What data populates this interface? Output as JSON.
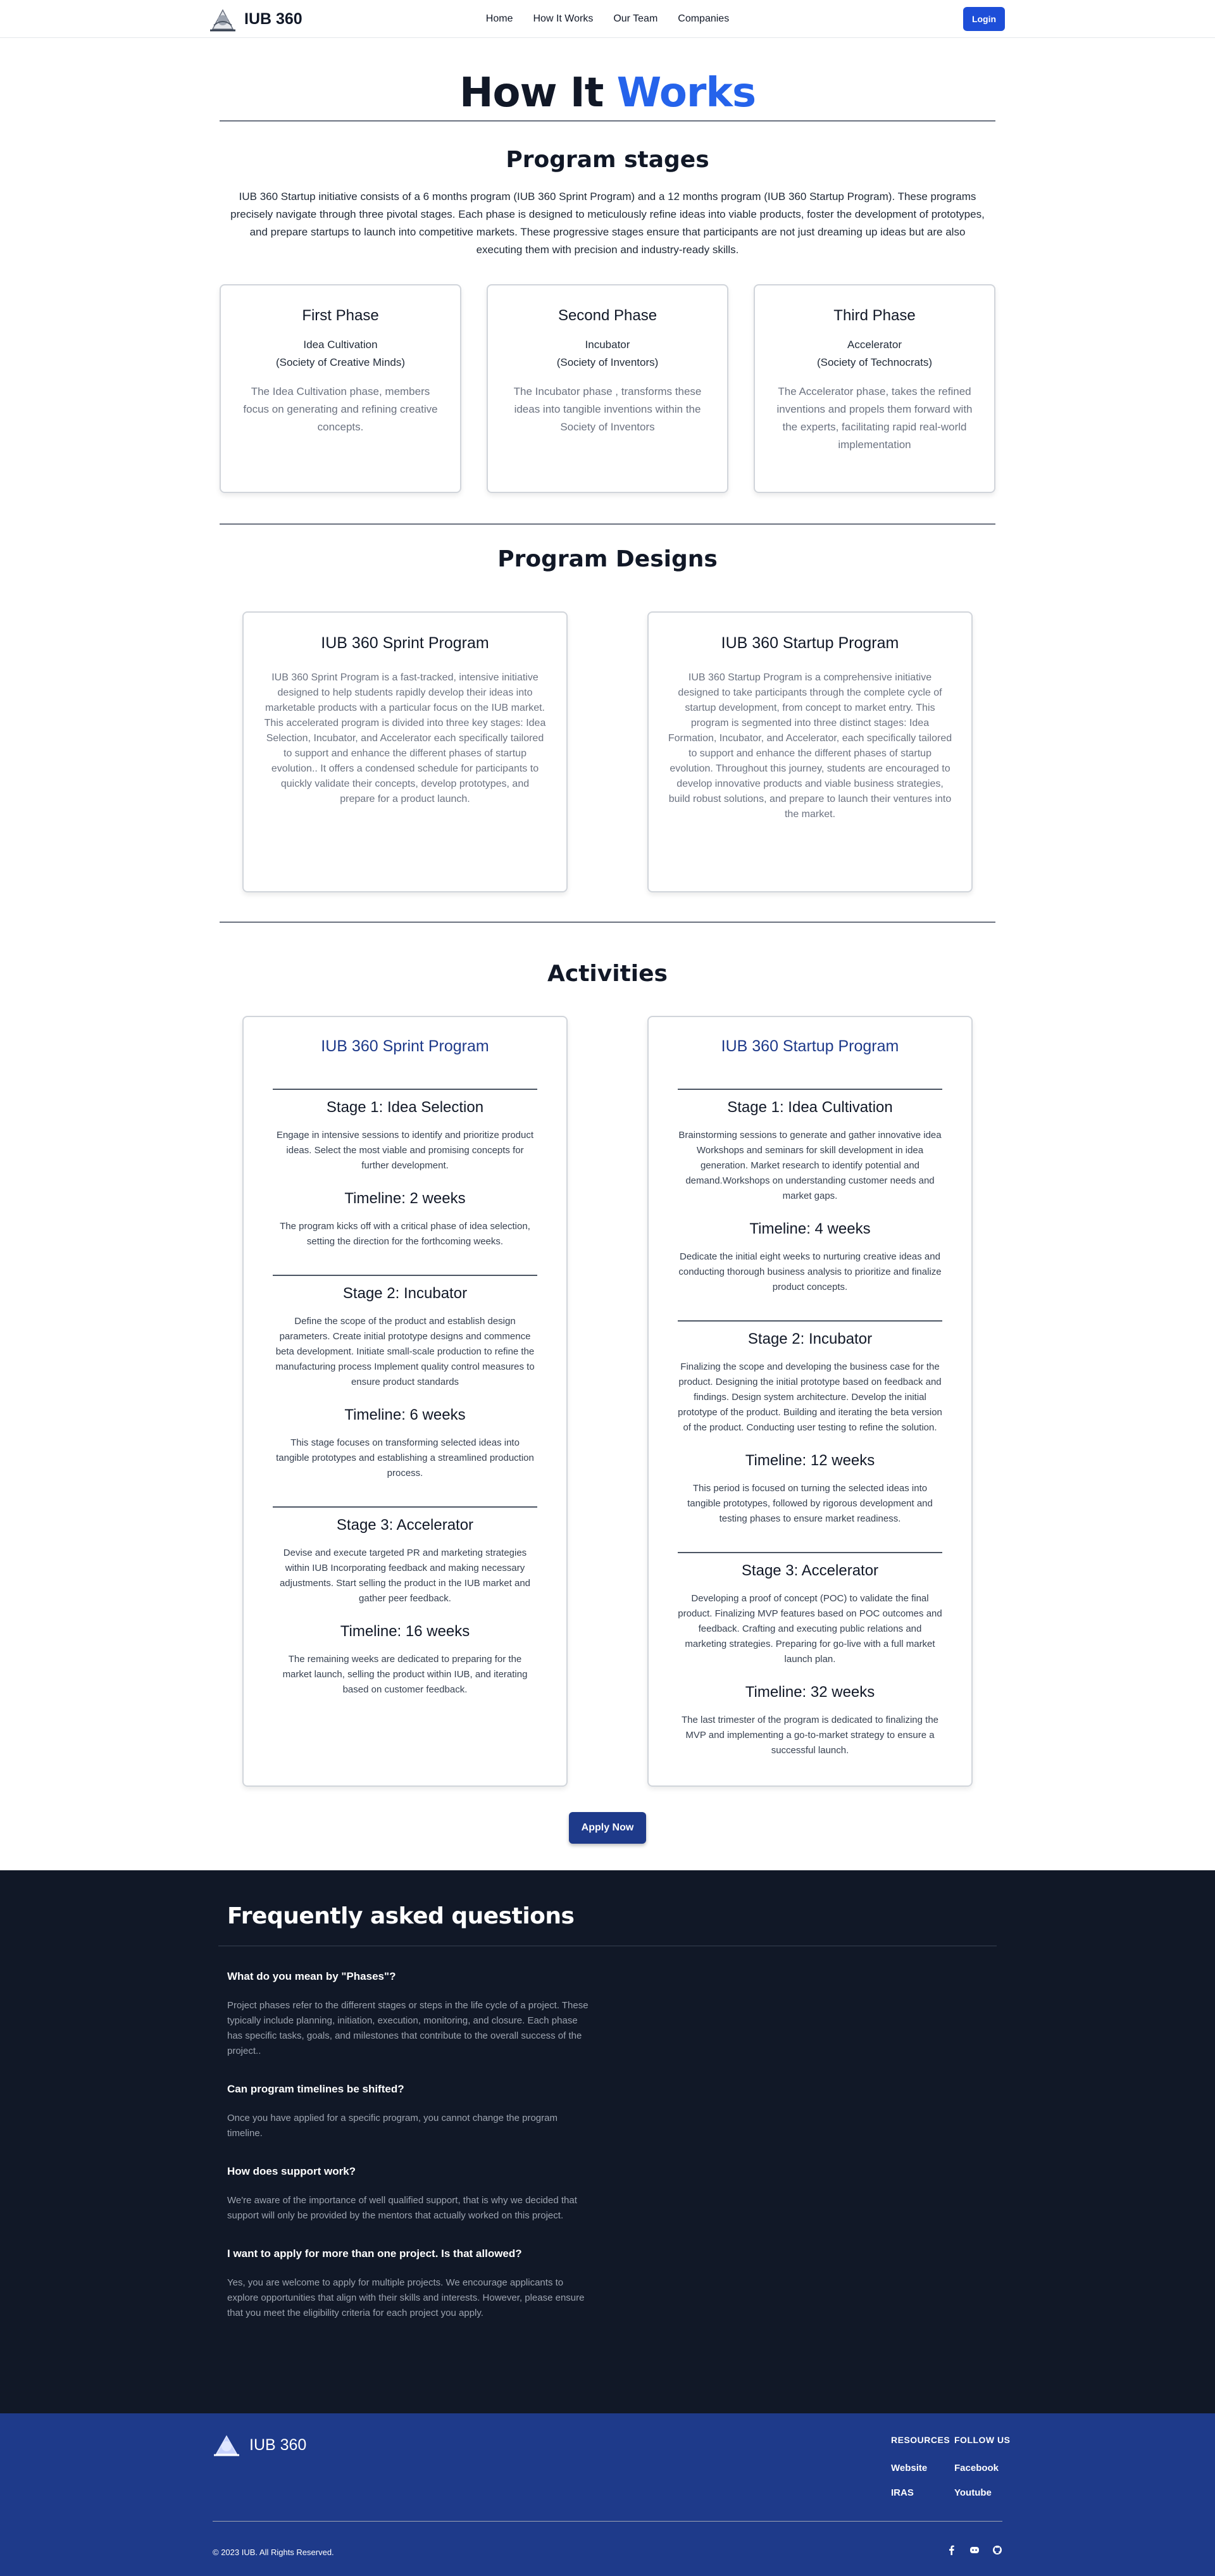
{
  "nav": {
    "brand": "IUB 360",
    "links": [
      "Home",
      "How It Works",
      "Our Team",
      "Companies"
    ],
    "login": "Login"
  },
  "title": {
    "main": "How It",
    "accent": "Works"
  },
  "stages": {
    "title": "Program stages",
    "intro": "IUB 360 Startup initiative consists of a 6 months program (IUB 360 Sprint Program) and a 12 months program (IUB 360 Startup Program). These programs precisely navigate through three pivotal stages. Each phase is designed to meticulously refine ideas into viable products, foster the development of prototypes, and prepare startups to launch into competitive markets. These progressive stages ensure that participants are not just dreaming up ideas but are also executing them with precision and industry-ready skills.",
    "phases": [
      {
        "name": "First Phase",
        "sub1": "Idea Cultivation",
        "sub2": "(Society of Creative Minds)",
        "desc": "The Idea Cultivation phase, members focus on generating and refining creative concepts."
      },
      {
        "name": "Second Phase",
        "sub1": "Incubator",
        "sub2": "(Society of Inventors)",
        "desc": "The Incubator phase , transforms these ideas into tangible inventions within the Society of Inventors"
      },
      {
        "name": "Third Phase",
        "sub1": "Accelerator",
        "sub2": "(Society of Technocrats)",
        "desc": "The Accelerator phase, takes the refined inventions and propels them forward with the experts, facilitating rapid real-world implementation"
      }
    ]
  },
  "designs": {
    "title": "Program Designs",
    "cards": [
      {
        "name": "IUB 360 Sprint Program",
        "desc": "IUB 360 Sprint Program is a fast-tracked, intensive initiative designed to help students rapidly develop their ideas into marketable products with a particular focus on the IUB market. This accelerated program is divided into three key stages: Idea Selection, Incubator, and Accelerator each specifically tailored to support and enhance the different phases of startup evolution.. It offers a condensed schedule for participants to quickly validate their concepts, develop prototypes, and prepare for a product launch."
      },
      {
        "name": "IUB 360 Startup Program",
        "desc": "IUB 360 Startup Program is a comprehensive initiative designed to take participants through the complete cycle of startup development, from concept to market entry. This program is segmented into three distinct stages: Idea Formation, Incubator, and Accelerator, each specifically tailored to support and enhance the different phases of startup evolution. Throughout this journey, students are encouraged to develop innovative products and viable business strategies, build robust solutions, and prepare to launch their ventures into the market."
      }
    ]
  },
  "activities": {
    "title": "Activities",
    "programs": [
      {
        "name": "IUB 360 Sprint Program",
        "stages": [
          {
            "title": "Stage 1: Idea Selection",
            "desc": "Engage in intensive sessions to identify and prioritize product ideas. Select the most viable and promising concepts for further development.",
            "timeline": "Timeline: 2 weeks",
            "time_desc": "The program kicks off with a critical phase of idea selection, setting the direction for the forthcoming weeks."
          },
          {
            "title": "Stage 2: Incubator",
            "desc": "Define the scope of the product and establish design parameters. Create initial prototype designs and commence beta development. Initiate small-scale production to refine the manufacturing process Implement quality control measures to ensure product standards",
            "timeline": "Timeline: 6 weeks",
            "time_desc": "This stage focuses on transforming selected ideas into tangible prototypes and establishing a streamlined production process."
          },
          {
            "title": "Stage 3: Accelerator",
            "desc": "Devise and execute targeted PR and marketing strategies within IUB Incorporating feedback and making necessary adjustments. Start selling the product in the IUB market and gather peer feedback.",
            "timeline": "Timeline: 16 weeks",
            "time_desc": "The remaining weeks are dedicated to preparing for the market launch, selling the product within IUB, and iterating based on customer feedback."
          }
        ]
      },
      {
        "name": "IUB 360 Startup Program",
        "stages": [
          {
            "title": "Stage 1: Idea Cultivation",
            "desc": "Brainstorming sessions to generate and gather innovative idea Workshops and seminars for skill development in idea generation. Market research to identify potential and demand.Workshops on understanding customer needs and market gaps.",
            "timeline": "Timeline: 4 weeks",
            "time_desc": "Dedicate the initial eight weeks to nurturing creative ideas and conducting thorough business analysis to prioritize and finalize product concepts."
          },
          {
            "title": "Stage 2: Incubator",
            "desc": "Finalizing the scope and developing the business case for the product. Designing the initial prototype based on feedback and findings. Design system architecture. Develop the initial prototype of the product. Building and iterating the beta version of the product. Conducting user testing to refine the solution.",
            "timeline": "Timeline: 12 weeks",
            "time_desc": "This period is focused on turning the selected ideas into tangible prototypes, followed by rigorous development and testing phases to ensure market readiness."
          },
          {
            "title": "Stage 3: Accelerator",
            "desc": "Developing a proof of concept (POC) to validate the final product. Finalizing MVP features based on POC outcomes and feedback. Crafting and executing public relations and marketing strategies. Preparing for go-live with a full market launch plan.",
            "timeline": "Timeline: 32 weeks",
            "time_desc": "The last trimester of the program is dedicated to finalizing the MVP and implementing a go-to-market strategy to ensure a successful launch."
          }
        ]
      }
    ],
    "apply": "Apply Now"
  },
  "faq": {
    "title": "Frequently asked questions",
    "items": [
      {
        "q": "What do you mean by \"Phases\"?",
        "a": "Project phases refer to the different stages or steps in the life cycle of a project. These typically include planning, initiation, execution, monitoring, and closure. Each phase has specific tasks, goals, and milestones that contribute to the overall success of the project.."
      },
      {
        "q": "Can program timelines be shifted?",
        "a": "Once you have applied for a specific program, you cannot change the program timeline."
      },
      {
        "q": "How does support work?",
        "a": "We're aware of the importance of well qualified support, that is why we decided that support will only be provided by the mentors that actually worked on this project."
      },
      {
        "q": "I want to apply for more than one project. Is that allowed?",
        "a": "Yes, you are welcome to apply for multiple projects. We encourage applicants to explore opportunities that align with their skills and interests. However, please ensure that you meet the eligibility criteria for each project you apply."
      }
    ]
  },
  "footer": {
    "brand": "IUB 360",
    "resources": {
      "head": "RESOURCES",
      "links": [
        "Website",
        "IRAS"
      ]
    },
    "follow": {
      "head": "FOLLOW US",
      "links": [
        "Facebook",
        "Youtube"
      ]
    },
    "copyright": "© 2023 IUB. All Rights Reserved.",
    "social_icons": [
      "facebook-icon",
      "discord-icon",
      "github-icon"
    ]
  }
}
